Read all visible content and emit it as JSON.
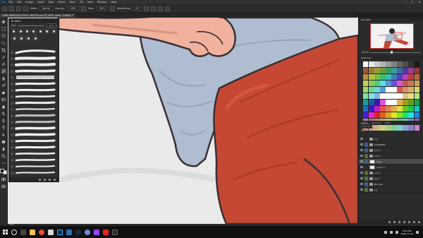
{
  "app": {
    "logo": "Ps"
  },
  "menu": [
    "File",
    "Edit",
    "Image",
    "Layer",
    "Type",
    "Select",
    "Filter",
    "3D",
    "View",
    "Window",
    "Help"
  ],
  "window_controls": [
    "–",
    "□",
    "✕"
  ],
  "options": {
    "mode_label": "Mode:",
    "mode_value": "Normal",
    "opacity_label": "Opacity:",
    "opacity_value": "100%",
    "flow_label": "Flow:",
    "flow_value": "100%",
    "smoothing_label": "Smoothing:",
    "smoothing_value": "0%"
  },
  "document": {
    "tab_title": "STRA NINEGAGE FIGHT SKETCH.psd @ 200% (body, RGB/8) *"
  },
  "brushes": {
    "title": "Brushes",
    "size_label": "Size:",
    "size_value": "43 px"
  },
  "right": {
    "navigator_title": "Navigator",
    "zoom_value": "36.54%",
    "swatches_title": "Swatches",
    "layers_tabs": [
      "Layers",
      "Channels",
      "Paths"
    ],
    "blend_mode": "Normal",
    "opacity": "Opacity: 100%",
    "fill": "Fill: 100%"
  },
  "layers": [
    {
      "name": "rim",
      "type": "folder",
      "tag": ""
    },
    {
      "name": "SCORPION",
      "type": "folder",
      "tag": "#3f5d8a"
    },
    {
      "name": "arm 1",
      "type": "folder",
      "tag": "#3f5d8a"
    },
    {
      "name": "arm 2",
      "type": "folder",
      "tag": "#556d33"
    },
    {
      "name": "body",
      "type": "layer",
      "tag": "#3f5d8a",
      "active": true
    },
    {
      "name": "Layer 17",
      "type": "layer",
      "tag": ""
    },
    {
      "name": "arm 3",
      "type": "folder",
      "tag": "#556d33"
    },
    {
      "name": "leg 2",
      "type": "folder",
      "tag": "#556d33"
    },
    {
      "name": "BG lines",
      "type": "folder",
      "tag": "#3f5d8a"
    },
    {
      "name": "bg",
      "type": "folder",
      "tag": "#556d33"
    }
  ],
  "status": {
    "zoom": "200%"
  },
  "taskbar": {
    "time": "9:50 PM",
    "date": "2020-11-02"
  },
  "colors": {
    "shirt": "#aebdd0",
    "shirt_shadow": "#94a6bd",
    "pants": "#c44834",
    "pants_light": "#d5553f",
    "skin": "#f1b29d",
    "outline": "#3a2f36",
    "canvas_bg": "#eaeaea"
  }
}
